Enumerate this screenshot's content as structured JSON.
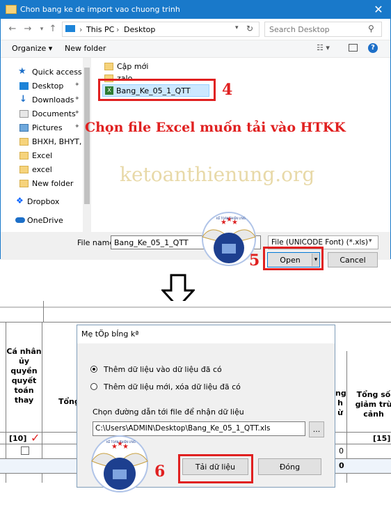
{
  "dialog1": {
    "title": "Chon bang ke de import vao chuong trinh",
    "close_glyph": "✕",
    "address": {
      "root": "This PC",
      "sep": "›",
      "folder": "Desktop"
    },
    "search_placeholder": "Search Desktop",
    "toolbar": {
      "organize": "Organize ▾",
      "new_folder": "New folder"
    },
    "sidebar": [
      {
        "label": "Quick access",
        "icon": "star-icon",
        "pinned": false
      },
      {
        "label": "Desktop",
        "icon": "desktop-icon",
        "pinned": true
      },
      {
        "label": "Downloads",
        "icon": "download-icon",
        "pinned": true
      },
      {
        "label": "Documents",
        "icon": "documents-icon",
        "pinned": true
      },
      {
        "label": "Pictures",
        "icon": "pictures-icon",
        "pinned": true
      },
      {
        "label": "BHXH, BHYT, BH",
        "icon": "folder-icon",
        "pinned": false
      },
      {
        "label": "Excel",
        "icon": "folder-icon",
        "pinned": false
      },
      {
        "label": "excel",
        "icon": "folder-icon",
        "pinned": false
      },
      {
        "label": "New folder",
        "icon": "folder-icon",
        "pinned": false
      },
      {
        "label": "Dropbox",
        "icon": "dropbox-icon",
        "pinned": false
      },
      {
        "label": "OneDrive",
        "icon": "onedrive-icon",
        "pinned": false
      }
    ],
    "files": [
      {
        "name": "Cập mới",
        "type": "folder"
      },
      {
        "name": "zalo",
        "type": "folder"
      },
      {
        "name": "Bang_Ke_05_1_QTT",
        "type": "xls"
      }
    ],
    "filename_label": "File name:",
    "filename_value": "Bang_Ke_05_1_QTT",
    "filetype_value": "File (UNICODE Font) (*.xls)",
    "open_label": "Open",
    "cancel_label": "Cancel"
  },
  "annotations": {
    "step4": "4",
    "step5": "5",
    "step6": "6",
    "caption": "Chọn file Excel muốn tải vào HTKK",
    "watermark": "ketoanthienung.org",
    "logo_text": "KẾ TOÁN THIÊN ƯNG",
    "arrow_color": "#000000",
    "red": "#e02020"
  },
  "sheet": {
    "col_header_1": "Cá nhân ủy quyền quyết toán thay",
    "col_header_2": "Tổng",
    "col_header_3_lines": [
      "ng",
      "h",
      "ừ"
    ],
    "col_header_4": "Tổng số giảm trừ cảnh",
    "tag_10": "[10]",
    "check_glyph": "✓",
    "tag_15": "[15]",
    "zero": "0"
  },
  "dialog2": {
    "title": "Mẹ tÖp bÍng kª",
    "option1": "Thêm dữ liệu vào dữ liệu đã có",
    "option2": "Thêm dữ liệu mới, xóa dữ liệu đã có",
    "selected_option": 1,
    "path_label": "Chọn đường dẫn tới file để nhận dữ liệu",
    "path_value": "C:\\Users\\ADMIN\\Desktop\\Bang_Ke_05_1_QTT.xls",
    "browse_label": "...",
    "load_label": "Tải dữ liệu",
    "close_label": "Đóng"
  }
}
